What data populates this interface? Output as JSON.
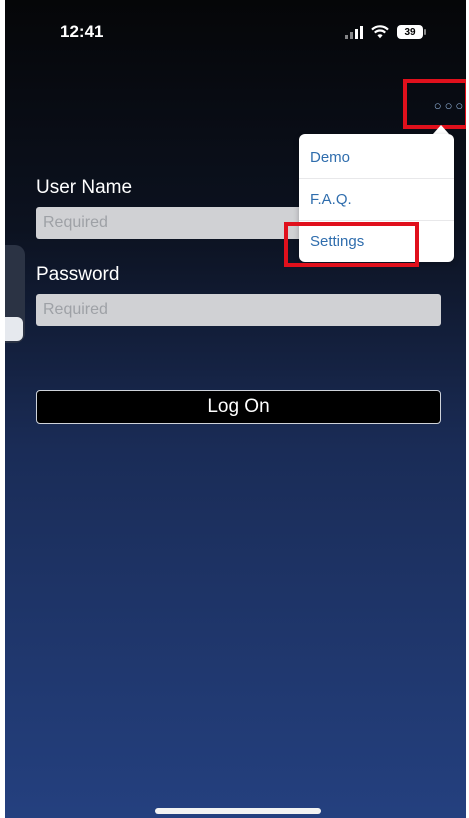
{
  "status_bar": {
    "time": "12:41",
    "battery": "39"
  },
  "header": {
    "more_icon": "ellipsis-icon"
  },
  "form": {
    "username_label": "User Name",
    "username_placeholder": "Required",
    "password_label": "Password",
    "password_placeholder": "Required",
    "logon_label": "Log On"
  },
  "menu": {
    "items": [
      {
        "label": "Demo"
      },
      {
        "label": "F.A.Q."
      },
      {
        "label": "Settings"
      }
    ]
  },
  "colors": {
    "highlight": "#e0101c",
    "menu_text": "#2f6dad",
    "field_bg": "#d0d1d4"
  }
}
